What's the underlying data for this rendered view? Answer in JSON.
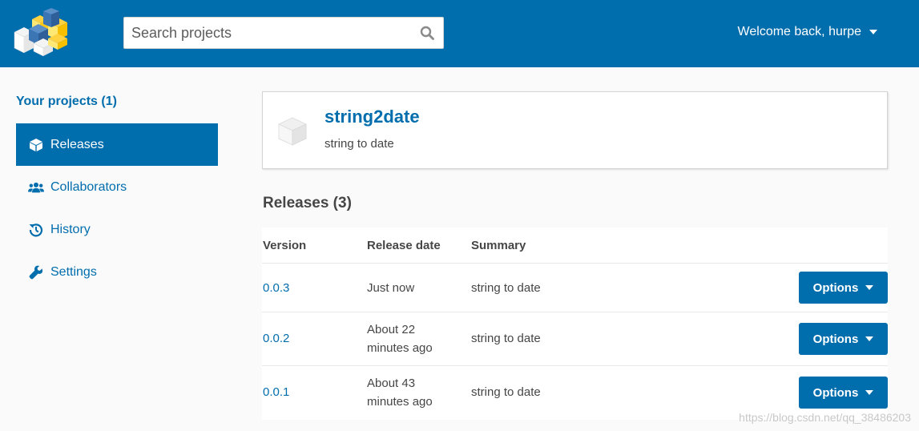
{
  "header": {
    "search_placeholder": "Search projects",
    "user_menu_label": "Welcome back, hurpe",
    "brand_color": "#006dad"
  },
  "sidebar": {
    "title": "Your projects (1)",
    "items": [
      {
        "label": "Releases",
        "icon": "box-icon",
        "active": true
      },
      {
        "label": "Collaborators",
        "icon": "users-icon",
        "active": false
      },
      {
        "label": "History",
        "icon": "history-icon",
        "active": false
      },
      {
        "label": "Settings",
        "icon": "wrench-icon",
        "active": false
      }
    ]
  },
  "project": {
    "name": "string2date",
    "description": "string to date"
  },
  "releases": {
    "title": "Releases (3)",
    "columns": [
      "Version",
      "Release date",
      "Summary"
    ],
    "rows": [
      {
        "version": "0.0.3",
        "date": "Just now",
        "summary": "string to date",
        "action": "Options"
      },
      {
        "version": "0.0.2",
        "date": "About 22 minutes ago",
        "summary": "string to date",
        "action": "Options"
      },
      {
        "version": "0.0.1",
        "date": "About 43 minutes ago",
        "summary": "string to date",
        "action": "Options"
      }
    ]
  },
  "watermark": "https://blog.csdn.net/qq_38486203"
}
